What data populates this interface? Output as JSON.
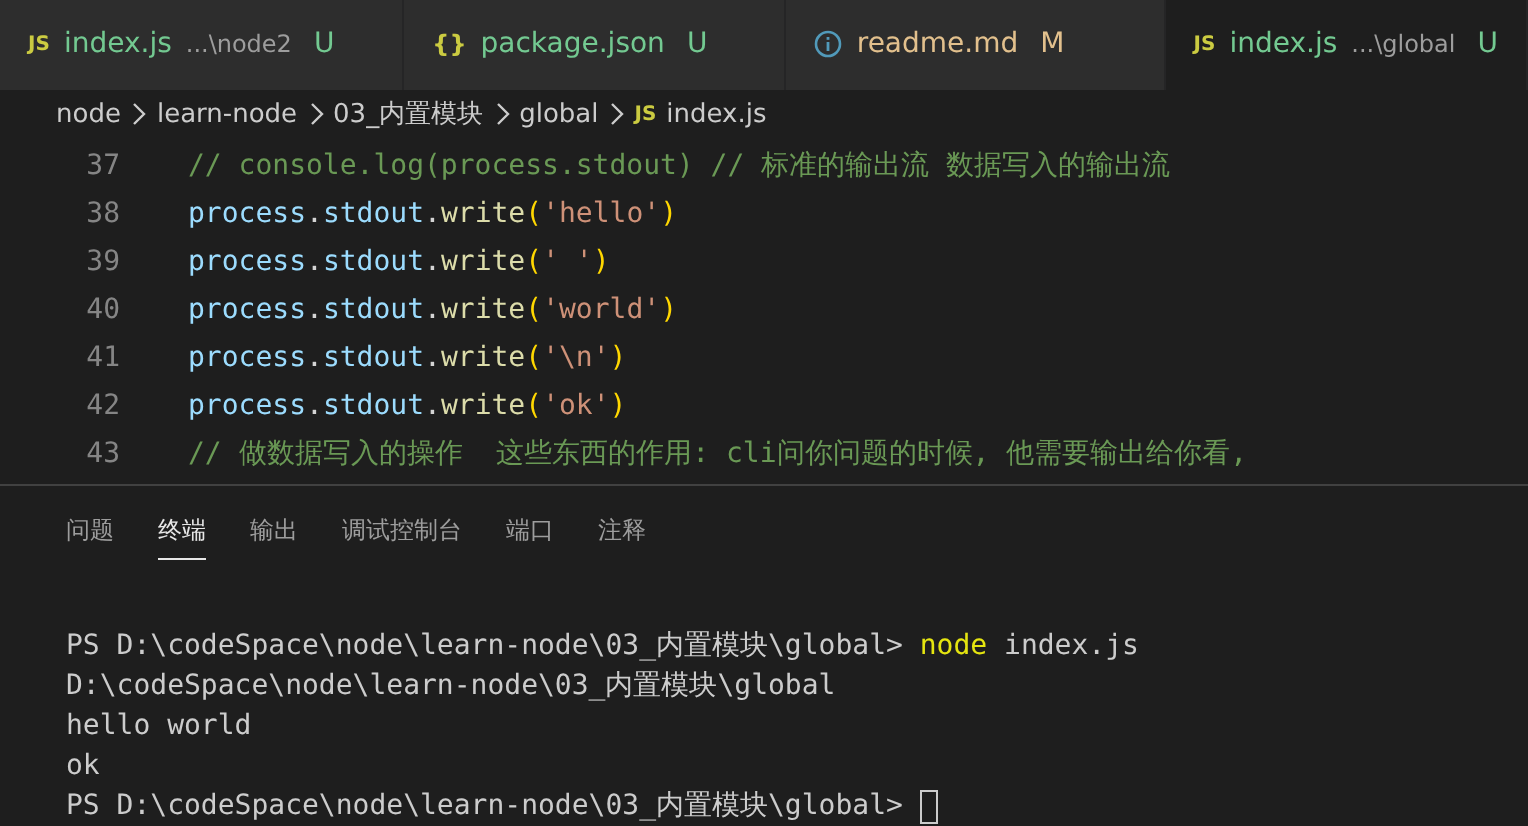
{
  "tabs": [
    {
      "kind": "js",
      "badge": "JS",
      "name": "index.js",
      "path": "...\\node2",
      "status": "U",
      "color": "#73c991",
      "selected": false
    },
    {
      "kind": "json",
      "badge": "{}",
      "name": "package.json",
      "status": "U",
      "color": "#73c991",
      "selected": false
    },
    {
      "kind": "info",
      "name": "readme.md",
      "status": "M",
      "color": "#e2c08d",
      "selected": false
    },
    {
      "kind": "js",
      "badge": "JS",
      "name": "index.js",
      "path": "...\\global",
      "status": "U",
      "color": "#73c991",
      "selected": true
    }
  ],
  "breadcrumb": [
    {
      "kind": "folder",
      "text": "node"
    },
    {
      "kind": "folder",
      "text": "learn-node"
    },
    {
      "kind": "folder",
      "text": "03_内置模块"
    },
    {
      "kind": "folder",
      "text": "global"
    },
    {
      "kind": "file",
      "badge": "JS",
      "text": "index.js"
    }
  ],
  "code": [
    {
      "number": "37",
      "segments": [
        {
          "kind": "comment",
          "text": "// console.log(process.stdout) // 标准的输出流 数据写入的输出流"
        }
      ]
    },
    {
      "number": "38",
      "segments": [
        {
          "kind": "variable",
          "text": "process"
        },
        {
          "kind": "punct",
          "text": "."
        },
        {
          "kind": "variable",
          "text": "stdout"
        },
        {
          "kind": "punct",
          "text": "."
        },
        {
          "kind": "function",
          "text": "write"
        },
        {
          "kind": "bracket",
          "text": "("
        },
        {
          "kind": "string",
          "text": "'hello'"
        },
        {
          "kind": "bracket",
          "text": ")"
        }
      ]
    },
    {
      "number": "39",
      "segments": [
        {
          "kind": "variable",
          "text": "process"
        },
        {
          "kind": "punct",
          "text": "."
        },
        {
          "kind": "variable",
          "text": "stdout"
        },
        {
          "kind": "punct",
          "text": "."
        },
        {
          "kind": "function",
          "text": "write"
        },
        {
          "kind": "bracket",
          "text": "("
        },
        {
          "kind": "string",
          "text": "' '"
        },
        {
          "kind": "bracket",
          "text": ")"
        }
      ]
    },
    {
      "number": "40",
      "segments": [
        {
          "kind": "variable",
          "text": "process"
        },
        {
          "kind": "punct",
          "text": "."
        },
        {
          "kind": "variable",
          "text": "stdout"
        },
        {
          "kind": "punct",
          "text": "."
        },
        {
          "kind": "function",
          "text": "write"
        },
        {
          "kind": "bracket",
          "text": "("
        },
        {
          "kind": "string",
          "text": "'world'"
        },
        {
          "kind": "bracket",
          "text": ")"
        }
      ]
    },
    {
      "number": "41",
      "segments": [
        {
          "kind": "variable",
          "text": "process"
        },
        {
          "kind": "punct",
          "text": "."
        },
        {
          "kind": "variable",
          "text": "stdout"
        },
        {
          "kind": "punct",
          "text": "."
        },
        {
          "kind": "function",
          "text": "write"
        },
        {
          "kind": "bracket",
          "text": "("
        },
        {
          "kind": "string",
          "text": "'\\n'"
        },
        {
          "kind": "bracket",
          "text": ")"
        }
      ]
    },
    {
      "number": "42",
      "segments": [
        {
          "kind": "variable",
          "text": "process"
        },
        {
          "kind": "punct",
          "text": "."
        },
        {
          "kind": "variable",
          "text": "stdout"
        },
        {
          "kind": "punct",
          "text": "."
        },
        {
          "kind": "function",
          "text": "write"
        },
        {
          "kind": "bracket",
          "text": "("
        },
        {
          "kind": "string",
          "text": "'ok'"
        },
        {
          "kind": "bracket",
          "text": ")"
        }
      ]
    },
    {
      "number": "43",
      "segments": [
        {
          "kind": "comment",
          "text": "// 做数据写入的操作  这些东西的作用: cli问你问题的时候, 他需要输出给你看,"
        }
      ]
    }
  ],
  "panel_tabs": [
    {
      "label": "问题",
      "selected": false
    },
    {
      "label": "终端",
      "selected": true
    },
    {
      "label": "输出",
      "selected": false
    },
    {
      "label": "调试控制台",
      "selected": false
    },
    {
      "label": "端口",
      "selected": false
    },
    {
      "label": "注释",
      "selected": false
    }
  ],
  "terminal": [
    {
      "segments": [
        {
          "kind": "output",
          "text": "PS D:\\codeSpace\\node\\learn-node\\03_内置模块\\global> "
        },
        {
          "kind": "command",
          "text": "node"
        },
        {
          "kind": "output",
          "text": " index.js"
        }
      ],
      "cursor": false
    },
    {
      "segments": [
        {
          "kind": "output",
          "text": "D:\\codeSpace\\node\\learn-node\\03_内置模块\\global"
        }
      ],
      "cursor": false
    },
    {
      "segments": [
        {
          "kind": "output",
          "text": "hello world"
        }
      ],
      "cursor": false
    },
    {
      "segments": [
        {
          "kind": "output",
          "text": "ok"
        }
      ],
      "cursor": false
    },
    {
      "segments": [
        {
          "kind": "output",
          "text": "PS D:\\codeSpace\\node\\learn-node\\03_内置模块\\global> "
        }
      ],
      "cursor": true
    }
  ]
}
